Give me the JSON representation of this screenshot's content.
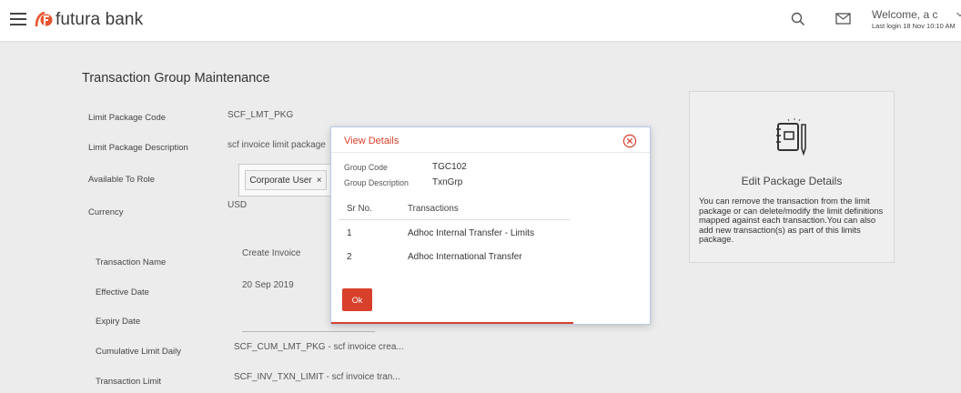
{
  "header": {
    "brand": "futura bank",
    "welcome": "Welcome, a c",
    "last_login": "Last login 18 Nov 10:10 AM",
    "icons": {
      "menu": "hamburger-icon",
      "search": "search-icon",
      "mail": "mail-icon",
      "caret": "chevron-down-icon"
    },
    "colors": {
      "brand_accent": "#e8542d",
      "brand_dark": "#b63a20"
    }
  },
  "page": {
    "title": "Transaction Group Maintenance",
    "fields": [
      {
        "label": "Limit Package Code",
        "value": "SCF_LMT_PKG"
      },
      {
        "label": "Limit Package Description",
        "value": "scf invoice limit package"
      },
      {
        "label": "Available To Role",
        "value": "Corporate User"
      },
      {
        "label": "Currency",
        "value": "USD"
      },
      {
        "label": "Transaction Name",
        "value": "Create Invoice"
      },
      {
        "label": "Effective Date",
        "value": "20 Sep 2019"
      },
      {
        "label": "Expiry Date",
        "value": ""
      },
      {
        "label": "Cumulative Limit Daily",
        "value": "SCF_CUM_LMT_PKG - scf invoice crea..."
      },
      {
        "label": "Transaction Limit",
        "value": "SCF_INV_TXN_LIMIT - scf invoice tran..."
      }
    ],
    "role_chip_remove": "×"
  },
  "edit_panel": {
    "title": "Edit Package Details",
    "description": "You can remove the transaction from the limit package or can delete/modify the limit definitions mapped against each transaction.You can also add new transaction(s) as part of this limits package.",
    "icon": "notebook-icon"
  },
  "modal": {
    "title": "View Details",
    "group_code_label": "Group Code",
    "group_code": "TGC102",
    "group_desc_label": "Group Description",
    "group_desc": "TxnGrp",
    "columns": [
      "Sr No.",
      "Transactions"
    ],
    "rows": [
      {
        "sr": "1",
        "txn": "Adhoc Internal Transfer - Limits"
      },
      {
        "sr": "2",
        "txn": "Adhoc International Transfer"
      }
    ],
    "ok_label": "Ok",
    "close_icon": "close-circle-icon",
    "accent": "#d9402b"
  }
}
